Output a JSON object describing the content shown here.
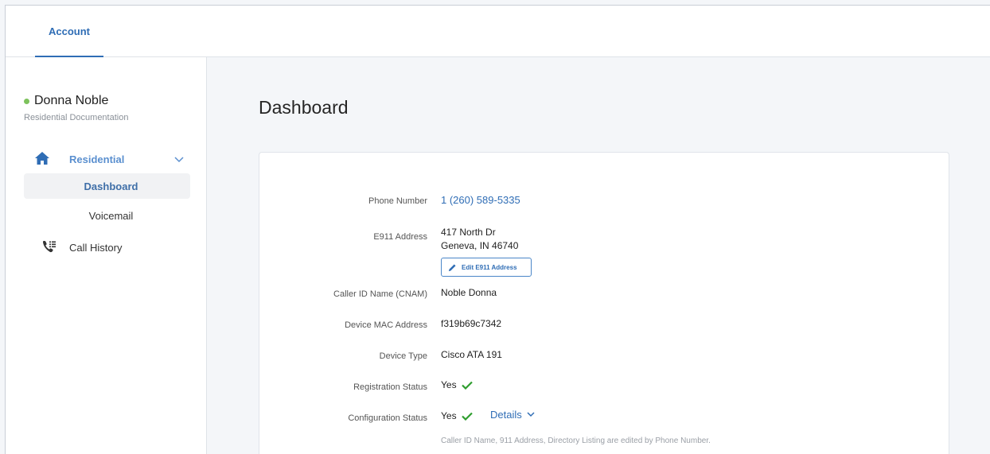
{
  "topbar": {
    "tab_account": "Account"
  },
  "sidebar": {
    "user_name": "Donna Noble",
    "user_subtitle": "Residential Documentation",
    "residential_label": "Residential",
    "dashboard_label": "Dashboard",
    "voicemail_label": "Voicemail",
    "call_history_label": "Call History"
  },
  "main": {
    "title": "Dashboard",
    "fields": {
      "phone_label": "Phone Number",
      "phone_value": "1 (260) 589-5335",
      "e911_label": "E911 Address",
      "e911_line1": "417 North Dr",
      "e911_line2": "Geneva, IN 46740",
      "edit_e911_button": "Edit E911 Address",
      "cnam_label": "Caller ID Name (CNAM)",
      "cnam_value": "Noble Donna",
      "mac_label": "Device MAC Address",
      "mac_value": "f319b69c7342",
      "device_type_label": "Device Type",
      "device_type_value": "Cisco ATA 191",
      "registration_label": "Registration Status",
      "registration_value": "Yes",
      "configuration_label": "Configuration Status",
      "configuration_value": "Yes",
      "details_label": "Details",
      "note": "Caller ID Name, 911 Address, Directory Listing are edited by Phone Number."
    }
  },
  "colors": {
    "accent": "#2f6db5",
    "status_online": "#7dc25c",
    "check_green": "#2e9d2e",
    "background": "#f4f6f9"
  },
  "icons": {
    "status": "status-dot",
    "home": "home-icon",
    "chevron": "chevron-down-icon",
    "call_history": "phone-list-icon",
    "edit": "pencil-icon",
    "check": "check-icon"
  }
}
